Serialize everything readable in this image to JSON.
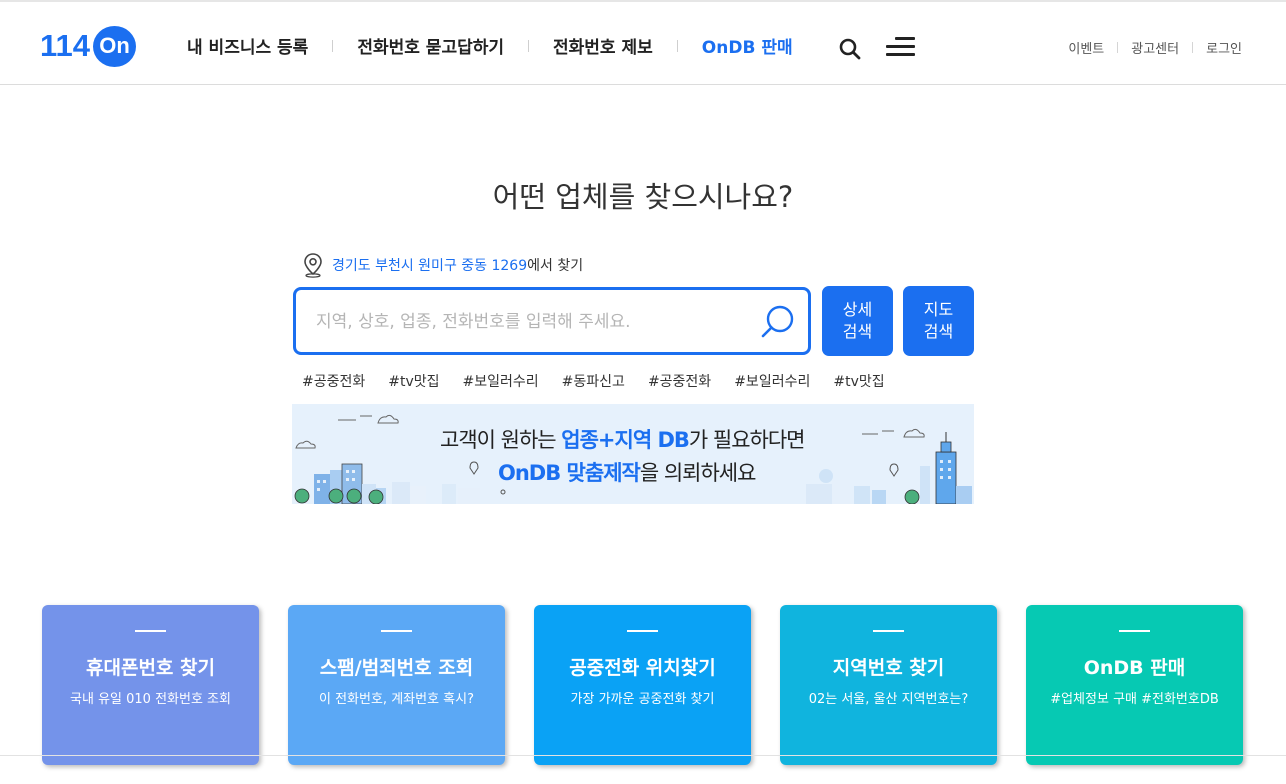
{
  "header": {
    "logo_num": "114",
    "logo_on": "On",
    "nav": [
      {
        "label": "내 비즈니스 등록"
      },
      {
        "label": "전화번호 묻고답하기"
      },
      {
        "label": "전화번호 제보"
      },
      {
        "label": "OnDB 판매"
      }
    ],
    "util": [
      {
        "label": "이벤트"
      },
      {
        "label": "광고센터"
      },
      {
        "label": "로그인"
      }
    ]
  },
  "hero": {
    "title": "어떤 업체를 찾으시나요?",
    "location_link": "경기도 부천시 원미구 중동 1269",
    "location_suffix": "에서 찾기",
    "search_placeholder": "지역, 상호, 업종, 전화번호를 입력해 주세요.",
    "btn_detail_1": "상세",
    "btn_detail_2": "검색",
    "btn_map_1": "지도",
    "btn_map_2": "검색",
    "tags": [
      "#공중전화",
      "#tv맛집",
      "#보일러수리",
      "#동파신고",
      "#공중전화",
      "#보일러수리",
      "#tv맛집"
    ]
  },
  "banner": {
    "line1_pre": "고객이 원하는 ",
    "line1_hl": "업종+지역 DB",
    "line1_post": "가 필요하다면",
    "line2_hl": "OnDB 맞춤제작",
    "line2_post": "을 의뢰하세요"
  },
  "cards": [
    {
      "title": "휴대폰번호 찾기",
      "sub": "국내 유일 010 전화번호 조회",
      "color": "#7493ea"
    },
    {
      "title": "스팸/범죄번호 조회",
      "sub": "이 전화번호, 계좌번호 혹시?",
      "color": "#5ba8f5"
    },
    {
      "title": "공중전화 위치찾기",
      "sub": "가장 가까운 공중전화 찾기",
      "color": "#0aa2f5"
    },
    {
      "title": "지역번호 찾기",
      "sub": "02는 서울, 울산 지역번호는?",
      "color": "#10b4de"
    },
    {
      "title": "OnDB 판매",
      "sub": "#업체정보 구매 #전화번호DB",
      "color": "#06c9b3"
    }
  ],
  "colors": {
    "brand": "#1b6ff0"
  },
  "icons": [
    "search-icon",
    "menu-icon",
    "location-pin-icon"
  ]
}
